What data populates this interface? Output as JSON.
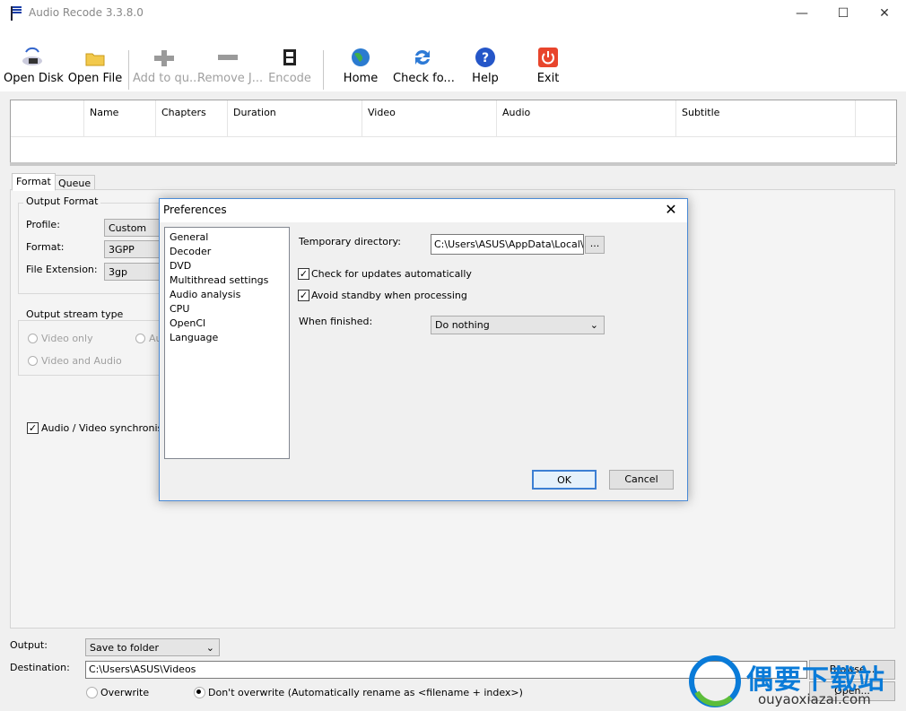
{
  "app": {
    "title": "Audio Recode 3.3.8.0"
  },
  "window_controls": {
    "minimize": "—",
    "maximize": "☐",
    "close": "✕"
  },
  "toolbar": {
    "open_disk": "Open Disk",
    "open_file": "Open File",
    "add_to_queue": "Add to qu...",
    "remove": "Remove J...",
    "encode": "Encode",
    "home": "Home",
    "check_for_updates": "Check fo...",
    "help": "Help",
    "exit": "Exit"
  },
  "file_table": {
    "columns": [
      "",
      "Name",
      "Chapters",
      "Duration",
      "Video",
      "Audio",
      "Subtitle"
    ]
  },
  "tabs": {
    "format": "Format",
    "queue": "Queue"
  },
  "output_format": {
    "group_title": "Output Format",
    "profile_label": "Profile:",
    "profile_value": "Custom",
    "format_label": "Format:",
    "format_value": "3GPP",
    "extension_label": "File Extension:",
    "extension_value": "3gp"
  },
  "stream_type": {
    "group_title": "Output stream type",
    "video_only": "Video only",
    "audio_only_partial": "Au",
    "video_and_audio": "Video and Audio"
  },
  "sync": {
    "label": "Audio / Video synchronisatio",
    "checked": true
  },
  "output": {
    "label": "Output:",
    "value": "Save to folder",
    "destination_label": "Destination:",
    "destination_value": "C:\\Users\\ASUS\\Videos",
    "browse": "Browse...",
    "open": "Open...",
    "overwrite": "Overwrite",
    "dont_overwrite": "Don't overwrite (Automatically rename as <filename + index>)"
  },
  "preferences": {
    "title": "Preferences",
    "close": "✕",
    "categories": [
      "General",
      "Decoder",
      "DVD",
      "Multithread settings",
      "Audio analysis",
      "CPU",
      "OpenCl",
      "Language"
    ],
    "temp_dir_label": "Temporary directory:",
    "temp_dir_value": "C:\\Users\\ASUS\\AppData\\Local\\Temp",
    "browse": "...",
    "check_updates": "Check for updates automatically",
    "avoid_standby": "Avoid standby when processing",
    "when_finished_label": "When finished:",
    "when_finished_value": "Do nothing",
    "ok": "OK",
    "cancel": "Cancel"
  },
  "watermark": {
    "text": "偶要下载站",
    "url": "ouyaoxiazai.com"
  },
  "colors": {
    "accent": "#4a8ad6",
    "watermark": "#0a7bd8",
    "exit_red": "#e8452c"
  }
}
